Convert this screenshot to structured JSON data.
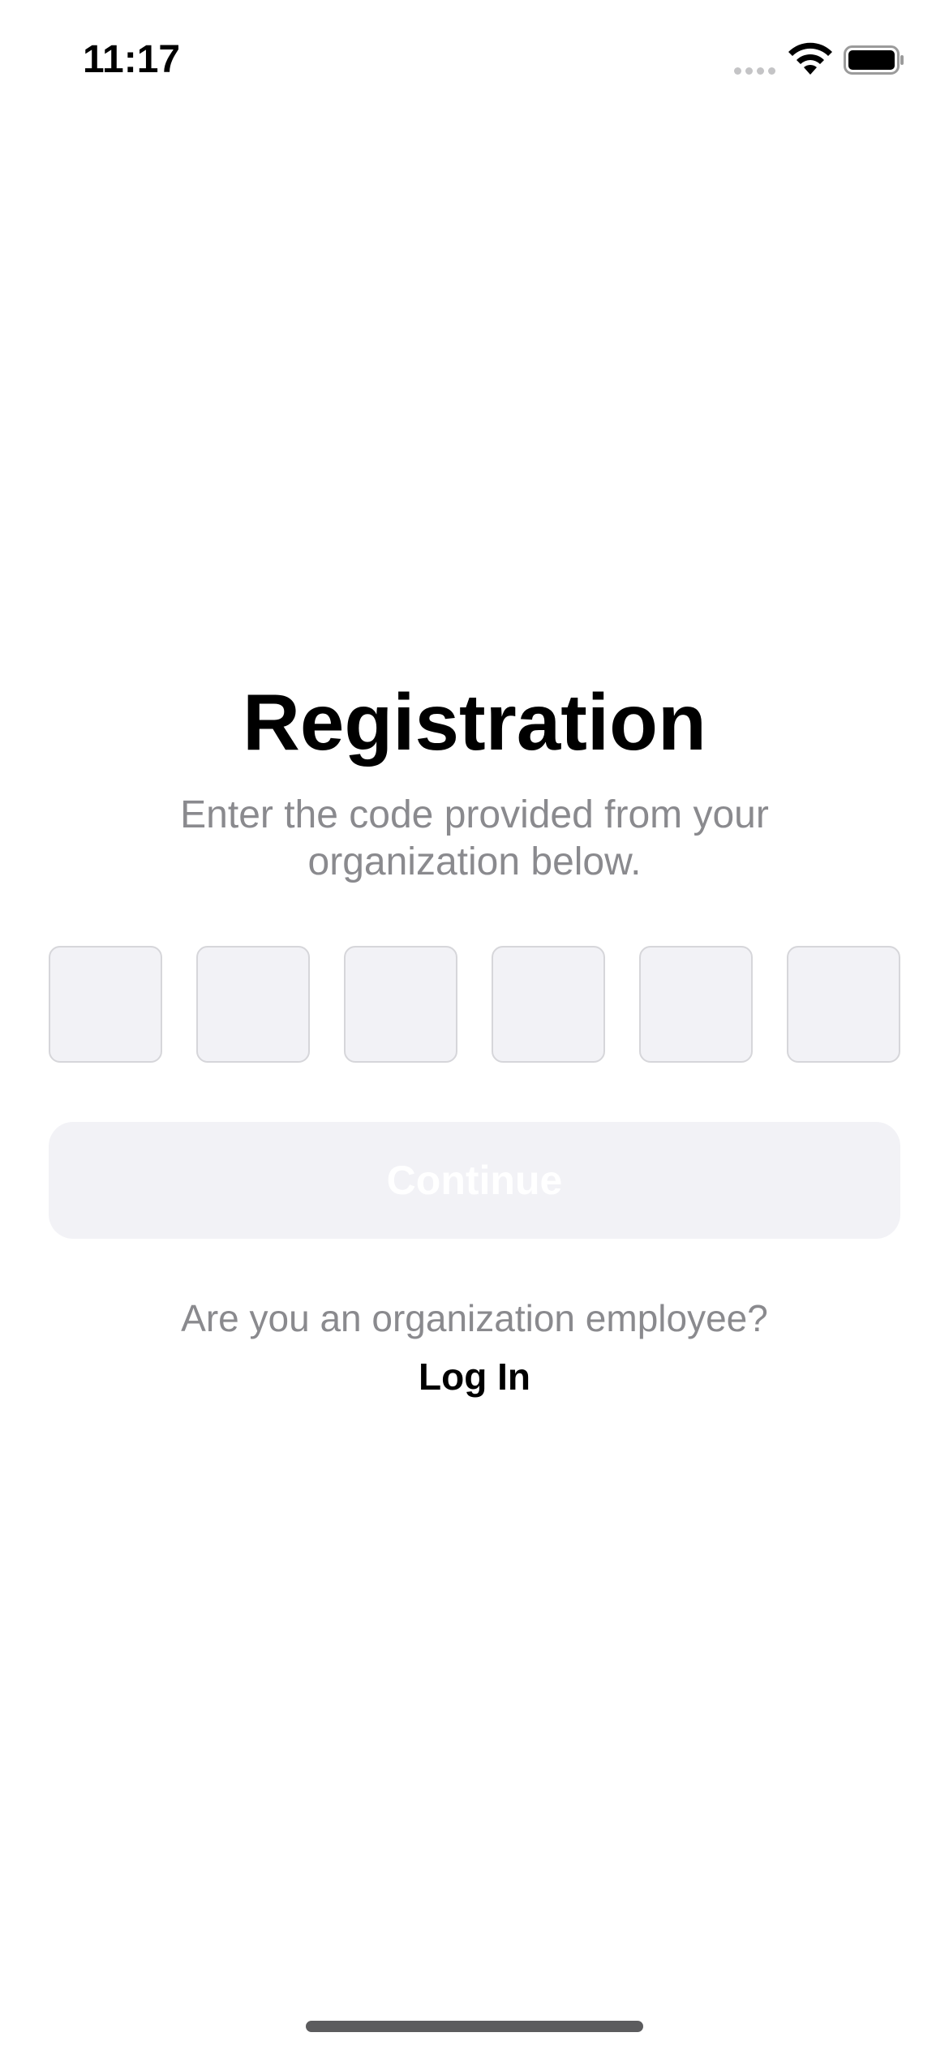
{
  "status_bar": {
    "time": "11:17",
    "icons": [
      "signal-icon",
      "wifi-icon",
      "battery-icon"
    ]
  },
  "registration": {
    "title": "Registration",
    "subtitle": "Enter the code provided from your organization below.",
    "code_boxes": [
      "",
      "",
      "",
      "",
      "",
      ""
    ],
    "continue_label": "Continue",
    "employee_question": "Are you an organization employee?",
    "login_label": "Log In"
  },
  "colors": {
    "background": "#ffffff",
    "box_fill": "#f2f2f6",
    "muted_text": "#8a8a8e",
    "primary_text": "#000000"
  }
}
